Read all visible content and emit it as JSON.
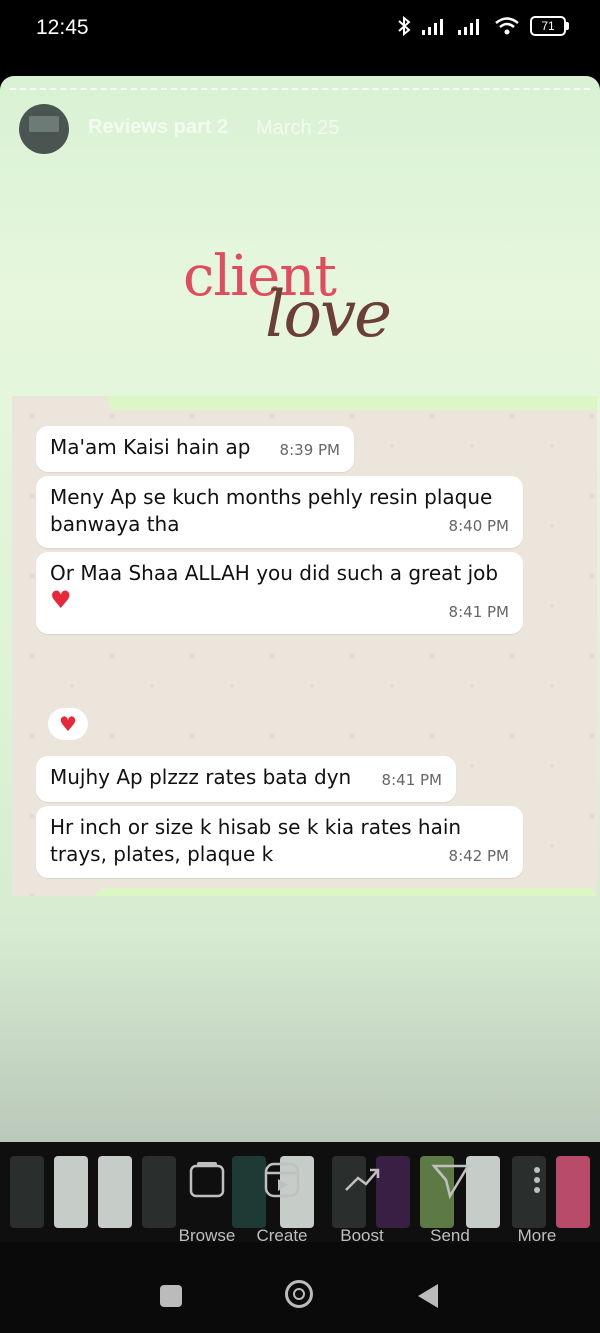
{
  "status_bar": {
    "time": "12:45",
    "battery": "71",
    "icons": [
      "bluetooth-icon",
      "signal-icon",
      "signal-icon",
      "wifi-icon",
      "battery-icon"
    ]
  },
  "story": {
    "title": "Reviews part 2",
    "date": "March 25",
    "logo": {
      "word1": "client",
      "word2": "love"
    },
    "chat": {
      "top_time": "8:39 PM",
      "messages": [
        {
          "text": "Ma'am Kaisi hain ap",
          "time": "8:39 PM"
        },
        {
          "text": "Meny Ap se kuch months pehly resin plaque banwaya tha",
          "time": "8:40 PM"
        },
        {
          "text": "Or Maa Shaa ALLAH you did such a great job",
          "time": "8:41 PM"
        },
        {
          "text": "Mujhy Ap plzzz rates bata dyn",
          "time": "8:41 PM"
        },
        {
          "text": "Hr inch or size k hisab se k kia rates hain trays, plates, plaque k",
          "time": "8:42 PM"
        }
      ],
      "reaction": "heart"
    }
  },
  "dock": {
    "actions": [
      {
        "label": "Browse",
        "icon": "browse-icon"
      },
      {
        "label": "Create",
        "icon": "create-reel-icon"
      },
      {
        "label": "Boost",
        "icon": "boost-icon"
      },
      {
        "label": "Send",
        "icon": "send-icon"
      },
      {
        "label": "More",
        "icon": "more-icon"
      }
    ]
  },
  "nav": {
    "buttons": [
      "recents-button",
      "home-button",
      "back-button"
    ]
  },
  "colors": {
    "story_bg": "#dff3d6",
    "logo_red": "#e14c5c",
    "logo_brown": "#6b3e36",
    "chat_bg": "#ece5dc",
    "heart": "#e8283a"
  }
}
